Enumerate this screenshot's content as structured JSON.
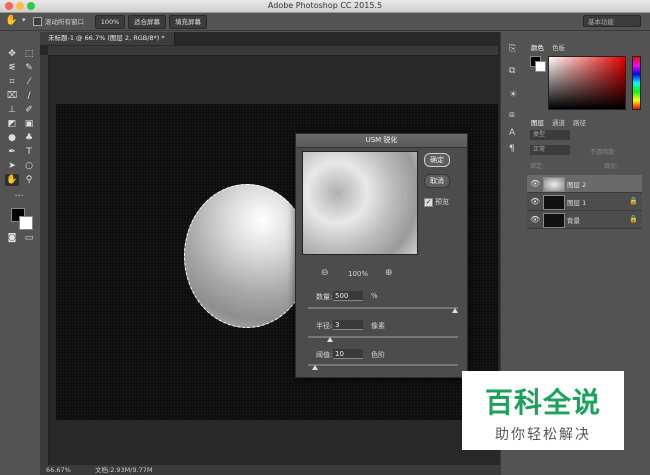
{
  "window": {
    "title": "Adobe Photoshop CC 2015.5"
  },
  "options_bar": {
    "scroll_all_label": "滚动所有窗口",
    "zoom_100": "100%",
    "fit_screen": "适合屏幕",
    "fill_screen": "填充屏幕",
    "workspace": "基本功能"
  },
  "document": {
    "tab_title": "未标题-1 @ 66.7% (图层 2, RGB/8*) *",
    "status_zoom": "66.67%",
    "status_doc": "文档:2.93M/9.77M"
  },
  "dialog": {
    "title": "USM 锐化",
    "ok": "确定",
    "cancel": "取消",
    "preview_label": "预览",
    "preview_checked": true,
    "zoom_level": "100%",
    "amount_label": "数量:",
    "amount_value": "500",
    "amount_unit": "%",
    "radius_label": "半径:",
    "radius_value": "3",
    "radius_unit": "像素",
    "threshold_label": "阈值:",
    "threshold_value": "10",
    "threshold_unit": "色阶"
  },
  "panels": {
    "color_tab": "颜色",
    "swatches_tab": "色板",
    "layers_tab": "图层",
    "channels_tab": "通道",
    "paths_tab": "路径",
    "kind_filter": "类型",
    "blend_mode": "正常",
    "opacity_label": "不透明度:",
    "lock_label": "锁定:",
    "fill_label": "填充:",
    "layers": [
      {
        "name": "图层 2",
        "selected": true
      },
      {
        "name": "图层 1",
        "selected": false
      },
      {
        "name": "背景",
        "selected": false
      }
    ]
  },
  "watermark": {
    "main": "百科全说",
    "sub": "助你轻松解决"
  },
  "colors": {
    "accent_green": "#1aa25a",
    "fg_swatch": "#000000",
    "bg_swatch": "#ffffff"
  }
}
